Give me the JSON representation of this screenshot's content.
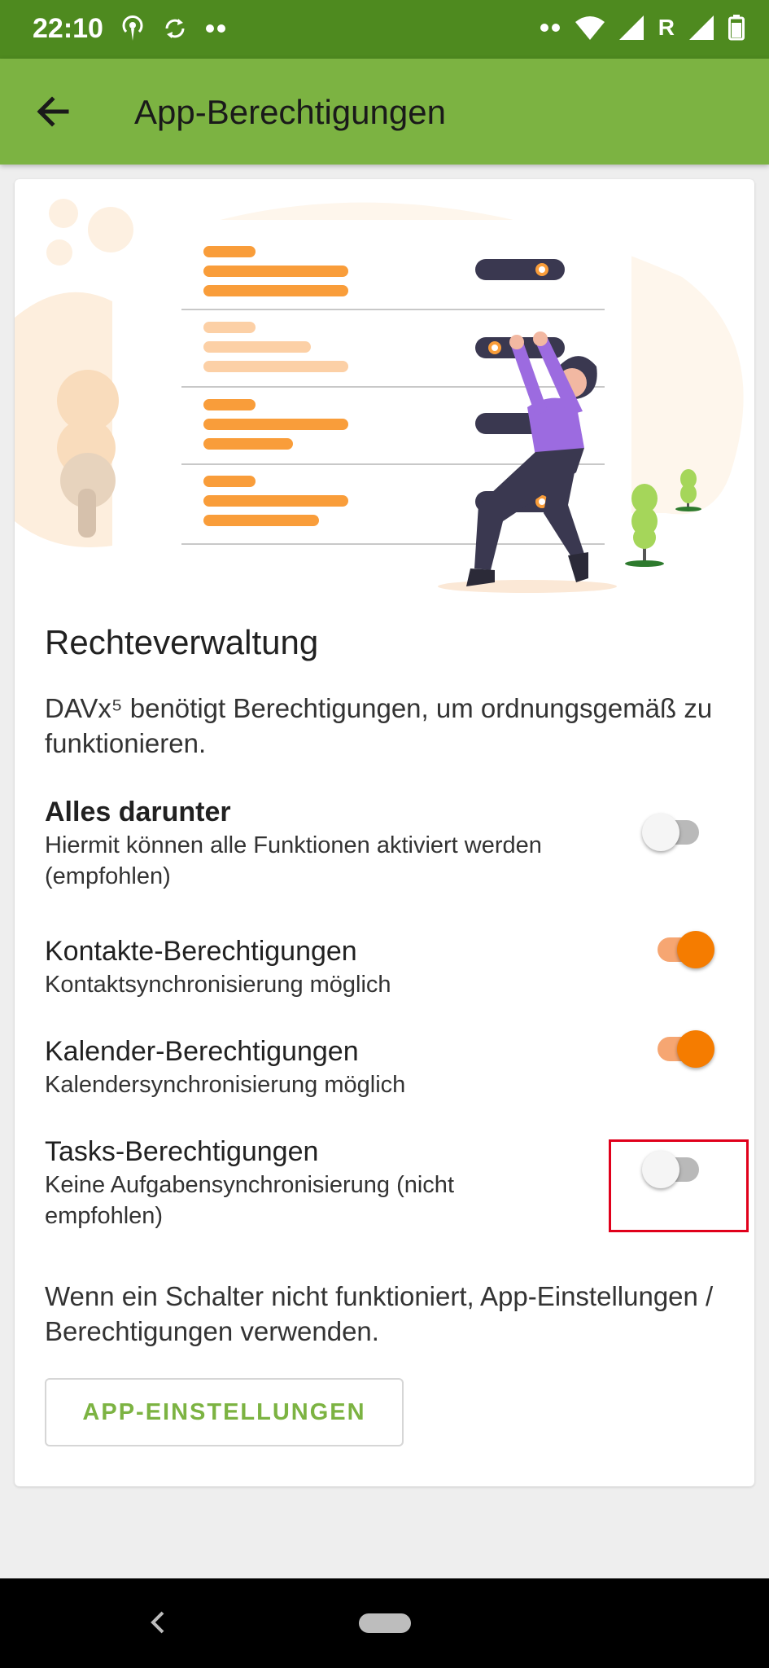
{
  "status_bar": {
    "time": "22:10",
    "network_letter": "R",
    "icons": [
      "hotspot-icon",
      "sync-icon",
      "more-dots-icon",
      "more-dots-icon",
      "wifi-icon",
      "signal-icon",
      "signal-icon",
      "battery-icon"
    ]
  },
  "app_bar": {
    "title": "App-Berechtigungen",
    "back_icon": "arrow-left-icon"
  },
  "content": {
    "heading": "Rechteverwaltung",
    "intro": "DAVx⁵ benötigt Berechtigungen, um ordnungsgemäß zu funktionieren.",
    "permissions": [
      {
        "title": "Alles darunter",
        "subtitle": "Hiermit können alle Funktionen aktiviert werden (empfohlen)",
        "enabled": false
      },
      {
        "title": "Kontakte-Berechtigungen",
        "subtitle": "Kontaktsynchronisierung möglich",
        "enabled": true
      },
      {
        "title": "Kalender-Berechtigungen",
        "subtitle": "Kalendersynchronisierung möglich",
        "enabled": true
      },
      {
        "title": "Tasks-Berechtigungen",
        "subtitle": "Keine Aufgabensynchronisierung (nicht empfohlen)",
        "enabled": false
      }
    ],
    "footer_text": "Wenn ein Schalter nicht funktioniert, App-Einstellungen / Berechtigungen verwenden.",
    "settings_button": "APP-EINSTELLUNGEN"
  },
  "colors": {
    "status_bar": "#4e8a1f",
    "app_bar": "#7cb342",
    "accent_orange": "#f57c00",
    "illustration_orange": "#f99d3a",
    "highlight": "#e0001b"
  }
}
